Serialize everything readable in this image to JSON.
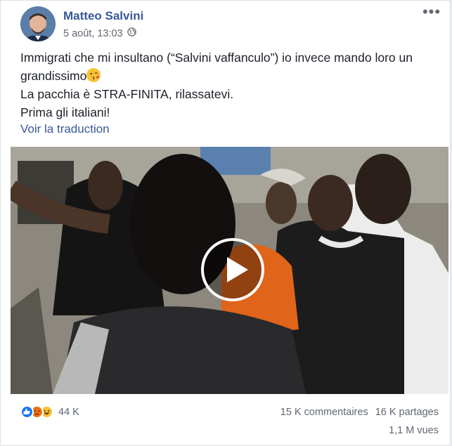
{
  "post": {
    "author": "Matteo Salvini",
    "date": "5 août, 13:03",
    "privacy_icon": "globe-icon",
    "more_icon": "more-options-icon",
    "text_lines": [
      "Immigrati che mi insultano (“Salvini vaffanculo”) io invece mando loro un",
      "grandissimo",
      "La pacchia è STRA-FINITA, rilassatevi.",
      "Prima gli italiani!"
    ],
    "emoji": "kiss-emoji-icon",
    "see_translation": "Voir la traduction"
  },
  "video": {
    "play_icon": "play-icon"
  },
  "footer": {
    "reaction_icons": [
      "like-icon",
      "angry-icon",
      "haha-icon"
    ],
    "reaction_count": "44 K",
    "comments": "15 K commentaires",
    "shares": "16 K partages",
    "views": "1,1 M vues"
  },
  "colors": {
    "link": "#385898",
    "secondary_text": "#606770",
    "like": "#1877f2",
    "angry": "#e9710f",
    "haha": "#f7c234"
  }
}
